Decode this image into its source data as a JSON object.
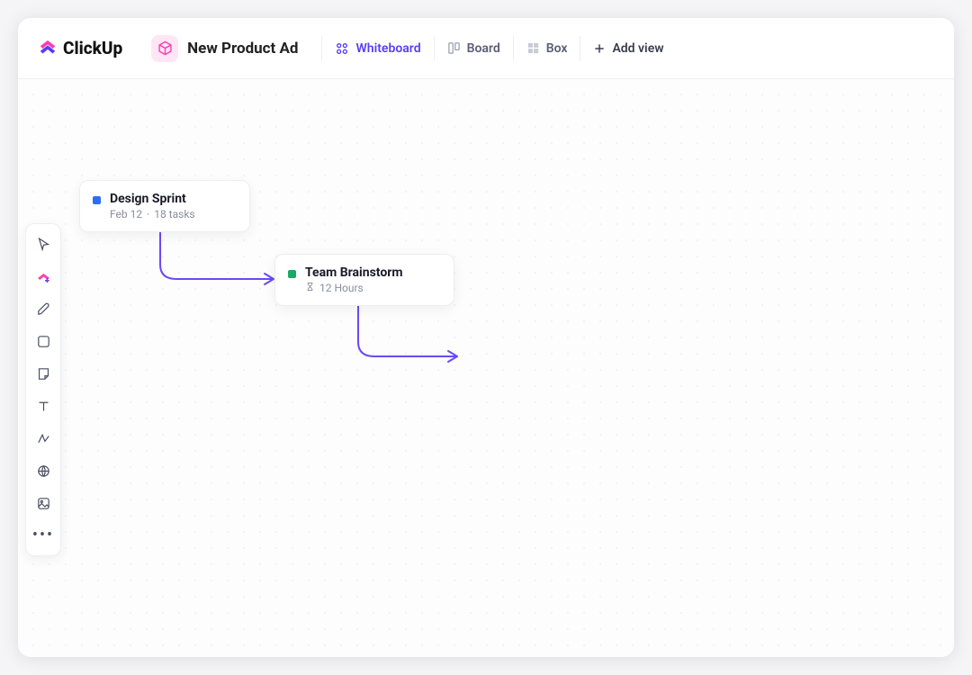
{
  "brand": {
    "name": "ClickUp"
  },
  "project": {
    "title": "New Product Ad"
  },
  "views": {
    "whiteboard": "Whiteboard",
    "board": "Board",
    "box": "Box",
    "add_view": "Add view"
  },
  "cards": {
    "design_sprint": {
      "title": "Design Sprint",
      "date": "Feb 12",
      "tasks": "18 tasks",
      "color": "#2b6ef5"
    },
    "team_brainstorm": {
      "title": "Team Brainstorm",
      "duration": "12 Hours",
      "color": "#1aa864"
    }
  },
  "toolbox": {
    "select": "select",
    "clickup": "clickup",
    "pen": "pen",
    "shape": "shape",
    "note": "note",
    "text": "text",
    "connector": "connector",
    "web": "web",
    "image": "image",
    "more": "more"
  },
  "colors": {
    "accent": "#5b3df5",
    "arrow": "#6a49f5"
  }
}
